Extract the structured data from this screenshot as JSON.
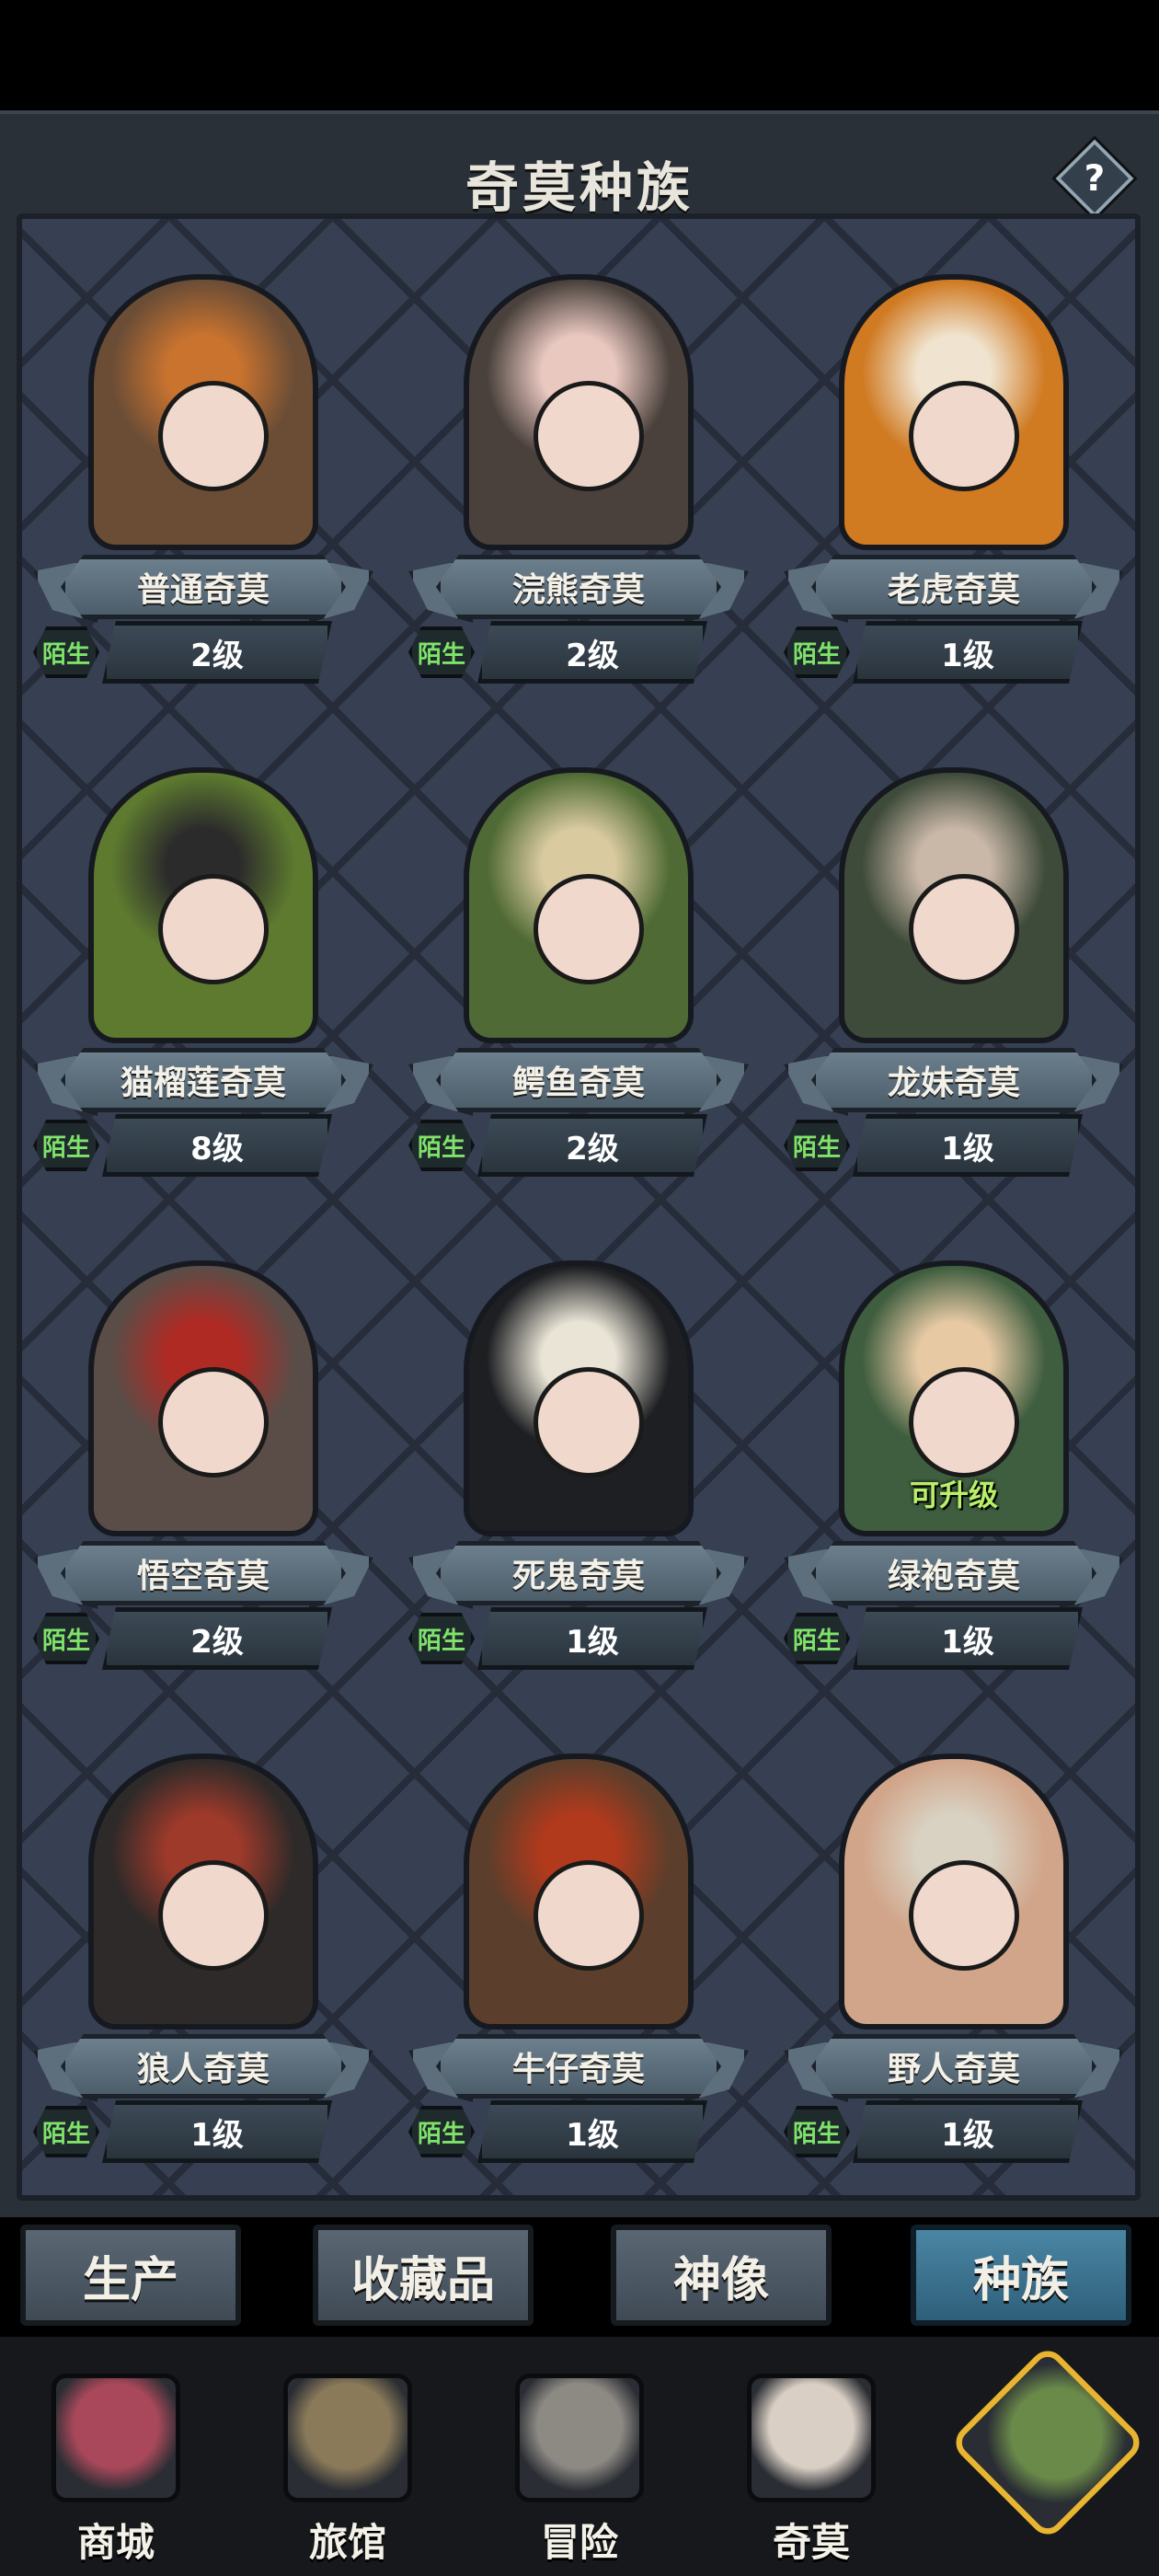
{
  "header": {
    "title": "奇莫种族",
    "help_label": "?"
  },
  "races": [
    {
      "name": "普通奇莫",
      "level": "2级",
      "status": "陌生",
      "upgrade": "",
      "color": "#6b4d36",
      "accent": "#c9732f"
    },
    {
      "name": "浣熊奇莫",
      "level": "2级",
      "status": "陌生",
      "upgrade": "",
      "color": "#4a413c",
      "accent": "#e9c8c0"
    },
    {
      "name": "老虎奇莫",
      "level": "1级",
      "status": "陌生",
      "upgrade": "",
      "color": "#d07a22",
      "accent": "#f0e4d0"
    },
    {
      "name": "猫榴莲奇莫",
      "level": "8级",
      "status": "陌生",
      "upgrade": "",
      "color": "#5d7a2f",
      "accent": "#2b2b2b"
    },
    {
      "name": "鳄鱼奇莫",
      "level": "2级",
      "status": "陌生",
      "upgrade": "",
      "color": "#4f6a34",
      "accent": "#d9caa0"
    },
    {
      "name": "龙妹奇莫",
      "level": "1级",
      "status": "陌生",
      "upgrade": "",
      "color": "#3f4b3a",
      "accent": "#c9b7a8"
    },
    {
      "name": "悟空奇莫",
      "level": "2级",
      "status": "陌生",
      "upgrade": "",
      "color": "#5a4d48",
      "accent": "#b02a24"
    },
    {
      "name": "死鬼奇莫",
      "level": "1级",
      "status": "陌生",
      "upgrade": "",
      "color": "#1d1f22",
      "accent": "#e9e4d6"
    },
    {
      "name": "绿袍奇莫",
      "level": "1级",
      "status": "陌生",
      "upgrade": "可升级",
      "color": "#3f5e3f",
      "accent": "#e7c9a4"
    },
    {
      "name": "狼人奇莫",
      "level": "1级",
      "status": "陌生",
      "upgrade": "",
      "color": "#2e2a29",
      "accent": "#9e3a2a"
    },
    {
      "name": "牛仔奇莫",
      "level": "1级",
      "status": "陌生",
      "upgrade": "",
      "color": "#5b3e2b",
      "accent": "#b23a1c"
    },
    {
      "name": "野人奇莫",
      "level": "1级",
      "status": "陌生",
      "upgrade": "",
      "color": "#d1a58a",
      "accent": "#d9d2c2"
    }
  ],
  "tabs": [
    {
      "label": "生产",
      "active": false
    },
    {
      "label": "收藏品",
      "active": false
    },
    {
      "label": "神像",
      "active": false
    },
    {
      "label": "种族",
      "active": true
    }
  ],
  "nav": [
    {
      "label": "商城",
      "icon": "shop-icon",
      "color": "#a8485a"
    },
    {
      "label": "旅馆",
      "icon": "inn-gate-icon",
      "color": "#8a7a5a"
    },
    {
      "label": "冒险",
      "icon": "crossed-swords-icon",
      "color": "#8d8a84"
    },
    {
      "label": "奇莫",
      "icon": "qimo-character-icon",
      "color": "#d9cfc4"
    },
    {
      "label": "",
      "icon": "island-map-icon",
      "color": "#6a8a4a",
      "active": true
    }
  ]
}
